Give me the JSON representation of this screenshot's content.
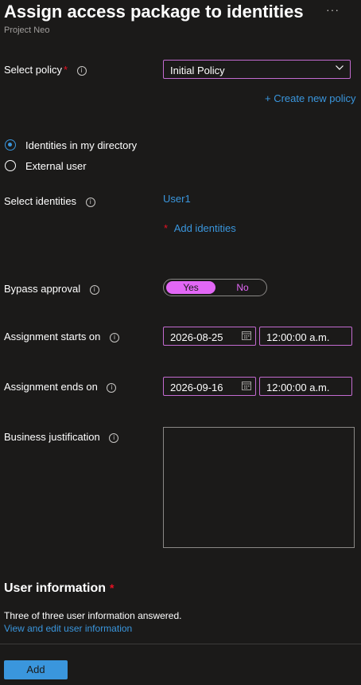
{
  "header": {
    "title": "Assign access package to identities",
    "subtitle": "Project Neo",
    "more_label": "···"
  },
  "policy": {
    "label": "Select policy",
    "required_mark": "*",
    "value": "Initial Policy",
    "create_link": "+ Create new policy"
  },
  "identity_type": {
    "options": [
      {
        "label": "Identities in my directory",
        "selected": true
      },
      {
        "label": "External user",
        "selected": false
      }
    ]
  },
  "identities": {
    "label": "Select identities",
    "selected_user": "User1",
    "required_mark": "*",
    "add_link": "Add identities"
  },
  "bypass": {
    "label": "Bypass approval",
    "yes": "Yes",
    "no": "No",
    "selected": "Yes"
  },
  "start": {
    "label": "Assignment starts on",
    "date": "2026-08-25",
    "time": "12:00:00 a.m."
  },
  "end": {
    "label": "Assignment ends on",
    "date": "2026-09-16",
    "time": "12:00:00 a.m."
  },
  "justification": {
    "label": "Business justification",
    "value": ""
  },
  "user_info": {
    "title": "User information",
    "required_mark": "*",
    "status": "Three of three user information answered.",
    "edit_link": "View and edit user information"
  },
  "footer": {
    "add_label": "Add"
  },
  "colors": {
    "accent": "#3a96dd",
    "focus_border": "#c36bd0",
    "toggle_on": "#e267f5",
    "required": "#e81123"
  },
  "icons": [
    "info-icon",
    "chevron-down-icon",
    "calendar-icon",
    "more-icon"
  ]
}
